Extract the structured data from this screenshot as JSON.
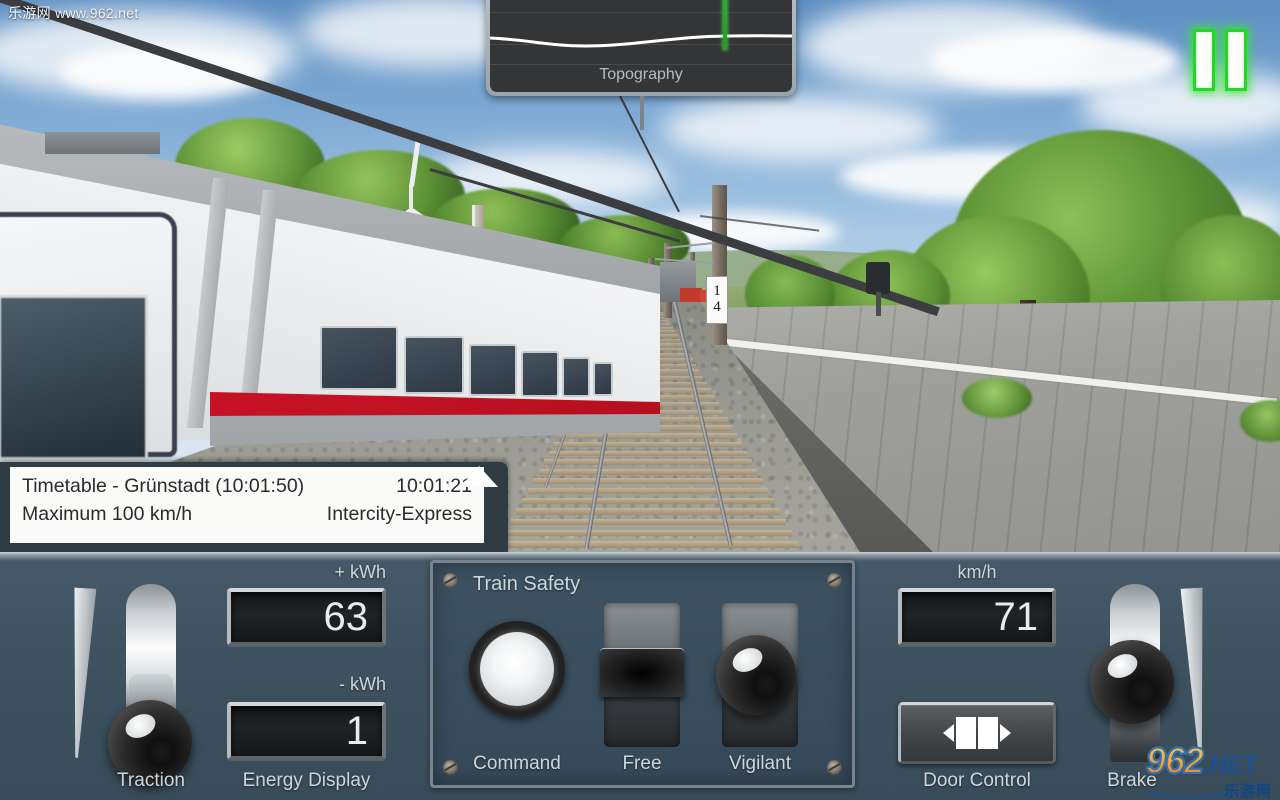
{
  "watermarks": {
    "top_left": "乐游网 www.962.net",
    "logo_digits": "962",
    "logo_tld": ".NET",
    "logo_cn": "乐游网"
  },
  "hud": {
    "pause_button_label": "Pause",
    "pause_glow_color": "#27d427"
  },
  "topography": {
    "title": "Topography",
    "marker_color": "#3ecb3e",
    "curve_color": "#ffffff",
    "position_percent": 77
  },
  "timetable": {
    "line1_left": "Timetable - Grünstadt (10:01:50)",
    "line1_right": "10:01:21",
    "line2_left": "Maximum 100 km/h",
    "line2_right": "Intercity-Express",
    "collapse_icon": "triangle-up-icon"
  },
  "scene": {
    "km_sign_top": "1",
    "km_sign_bottom": "4",
    "train_name": "Intercity-Express",
    "train_stripe_color": "#d2142a"
  },
  "controls": {
    "traction": {
      "label": "Traction"
    },
    "energy": {
      "label": "Energy Display",
      "positive_unit": "+ kWh",
      "positive_value": "63",
      "negative_unit": "- kWh",
      "negative_value": "1"
    },
    "safety": {
      "title": "Train Safety",
      "command_label": "Command",
      "free_label": "Free",
      "vigilant_label": "Vigilant"
    },
    "speed": {
      "unit": "km/h",
      "value": "71"
    },
    "door": {
      "label": "Door Control",
      "icon": "doors-open-icon"
    },
    "brake": {
      "label": "Brake"
    }
  },
  "colors": {
    "panel_bg": "#3e5260",
    "panel_text": "#cfd6da",
    "lcd_bg": "#16181a",
    "lcd_text": "#e9eced",
    "timetable_frame": "#2f3c44",
    "timetable_paper": "#fafaf8"
  }
}
